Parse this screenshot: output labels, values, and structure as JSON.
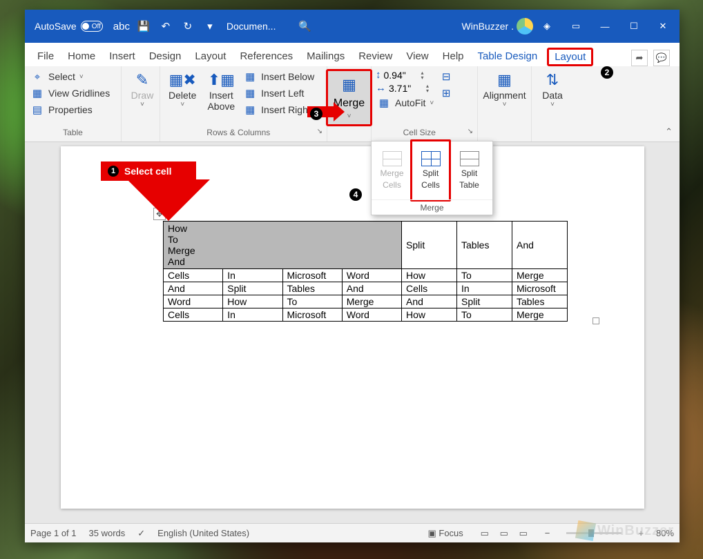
{
  "titlebar": {
    "autosave_label": "AutoSave",
    "autosave_state": "Off",
    "doc_title": "Documen...",
    "user_label": "WinBuzzer ."
  },
  "tabs": {
    "file": "File",
    "home": "Home",
    "insert": "Insert",
    "design": "Design",
    "layout": "Layout",
    "references": "References",
    "mailings": "Mailings",
    "review": "Review",
    "view": "View",
    "help": "Help",
    "table_design": "Table Design",
    "table_layout": "Layout"
  },
  "ribbon": {
    "table_group": {
      "label": "Table",
      "select": "Select",
      "gridlines": "View Gridlines",
      "properties": "Properties"
    },
    "draw_group": {
      "label": "Draw"
    },
    "rows_cols_group": {
      "label": "Rows & Columns",
      "delete": "Delete",
      "insert_above": "Insert Above",
      "insert_below": "Insert Below",
      "insert_left": "Insert Left",
      "insert_right": "Insert Right"
    },
    "merge_group": {
      "label": "Merge",
      "merge_btn": "Merge",
      "merge_cells": "Merge Cells",
      "split_cells": "Split Cells",
      "split_table": "Split Table"
    },
    "cellsize_group": {
      "label": "Cell Size",
      "height": "0.94\"",
      "width": "3.71\"",
      "autofit": "AutoFit"
    },
    "alignment_group": {
      "label": "Alignment"
    },
    "data_group": {
      "label": "Data"
    }
  },
  "callouts": {
    "c1": "Select cell"
  },
  "doc": {
    "merged_lines": [
      "How",
      "To",
      "Merge",
      "And"
    ],
    "row0_tail": [
      "Split",
      "Tables",
      "And"
    ],
    "rows": [
      [
        "Cells",
        "In",
        "Microsoft",
        "Word",
        "How",
        "To",
        "Merge"
      ],
      [
        "And",
        "Split",
        "Tables",
        "And",
        "Cells",
        "In",
        "Microsoft"
      ],
      [
        "Word",
        "How",
        "To",
        "Merge",
        "And",
        "Split",
        "Tables"
      ],
      [
        "Cells",
        "In",
        "Microsoft",
        "Word",
        "How",
        "To",
        "Merge"
      ]
    ]
  },
  "statusbar": {
    "page": "Page 1 of 1",
    "words": "35 words",
    "lang": "English (United States)",
    "focus": "Focus",
    "zoom": "80%"
  },
  "watermark": "WinBuzzer"
}
